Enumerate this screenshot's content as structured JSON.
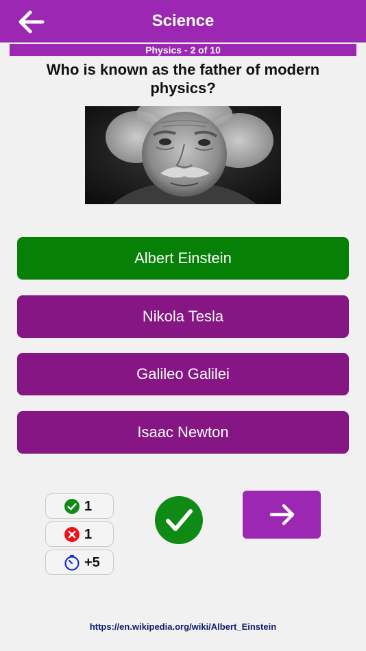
{
  "header": {
    "title": "Science",
    "back_icon": "arrow-left-icon"
  },
  "progress": {
    "label": "Physics - 2 of 10"
  },
  "question": {
    "text": "Who is known as the father of modern physics?"
  },
  "image": {
    "subject": "portrait photo"
  },
  "answers": [
    {
      "label": "Albert Einstein",
      "state": "correct",
      "color": "#078007"
    },
    {
      "label": "Nikola Tesla",
      "state": "default",
      "color": "#851683"
    },
    {
      "label": "Galileo Galilei",
      "state": "default",
      "color": "#851683"
    },
    {
      "label": "Isaac Newton",
      "state": "default",
      "color": "#851683"
    }
  ],
  "stats": {
    "correct": {
      "value": "1",
      "icon": "check-circle-icon"
    },
    "wrong": {
      "value": "1",
      "icon": "x-circle-icon"
    },
    "time": {
      "value": "+5",
      "icon": "timer-icon"
    }
  },
  "result": {
    "icon": "checkmark-icon",
    "color": "#0f8a14"
  },
  "next_button": {
    "icon": "arrow-right-icon"
  },
  "source": {
    "link": "https://en.wikipedia.org/wiki/Albert_Einstein"
  },
  "colors": {
    "accent": "#9b27b3",
    "answer_default": "#851683",
    "answer_correct": "#078007"
  }
}
